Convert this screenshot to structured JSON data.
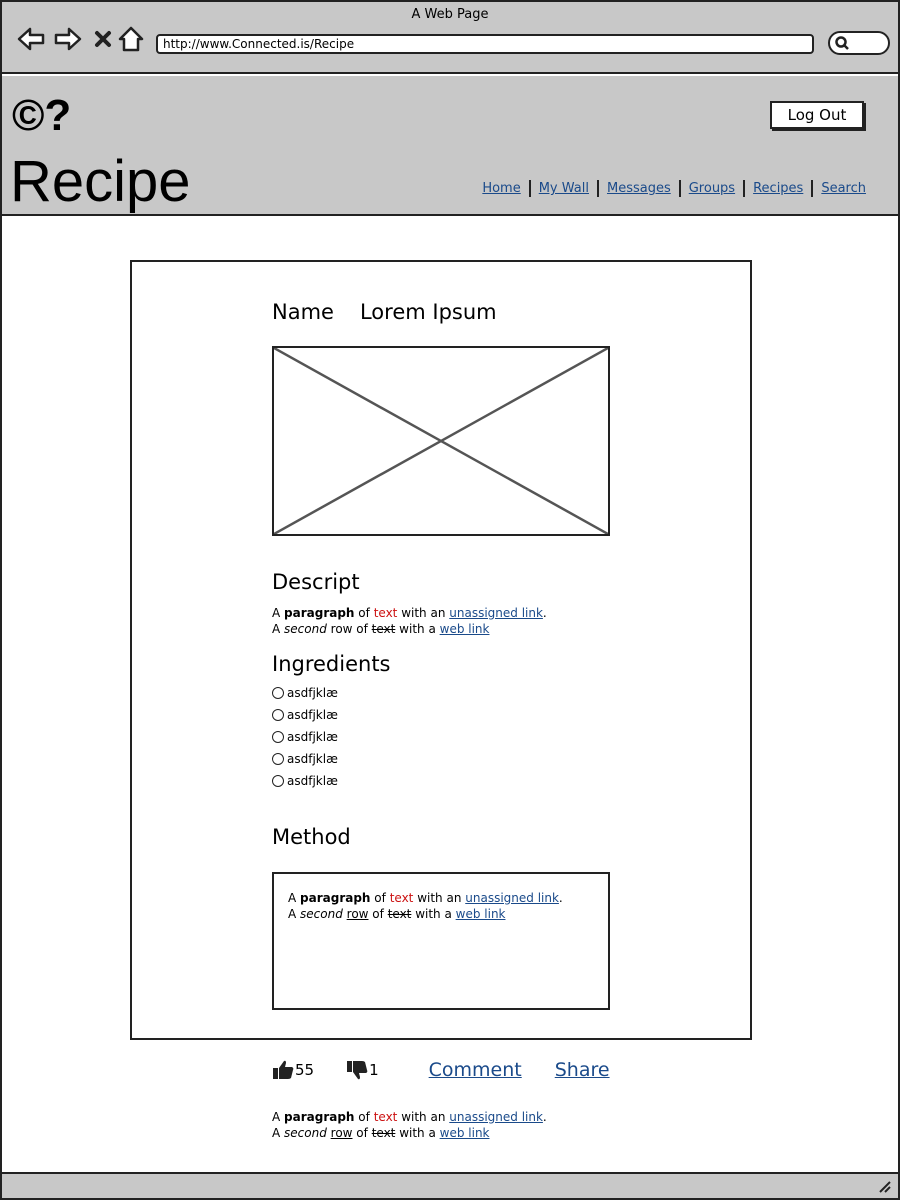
{
  "window": {
    "title": "A Web Page"
  },
  "browser": {
    "url": "http://www.Connected.is/Recipe"
  },
  "header": {
    "logo": "©?",
    "page_title": "Recipe",
    "logout_label": "Log Out",
    "nav": [
      "Home",
      "My Wall",
      "Messages",
      "Groups",
      "Recipes",
      "Search"
    ]
  },
  "recipe": {
    "name_label": "Name",
    "name_value": "Lorem Ipsum",
    "description_heading": "Descript",
    "ingredients_heading": "Ingredients",
    "ingredients": [
      "asdfjklæ",
      "asdfjklæ",
      "asdfjklæ",
      "asdfjklæ",
      "asdfjklæ"
    ],
    "method_heading": "Method"
  },
  "paragraph": {
    "l1_a": "A ",
    "l1_bold": "paragraph",
    "l1_b": " of ",
    "l1_red": "text",
    "l1_c": " with an ",
    "l1_link": "unassigned link",
    "l1_d": ".",
    "l2_a": "A ",
    "l2_italic": "second",
    "l2_row": " row",
    "l2_b": " of ",
    "l2_strike": "text",
    "l2_c": " with a ",
    "l2_link": "web link"
  },
  "actions": {
    "likes": "55",
    "dislikes": "1",
    "comment_label": "Comment",
    "share_label": "Share"
  },
  "colors": {
    "chrome_gray": "#c8c8c8",
    "link_blue": "#1a4a8a",
    "text_red": "#cc1111"
  }
}
